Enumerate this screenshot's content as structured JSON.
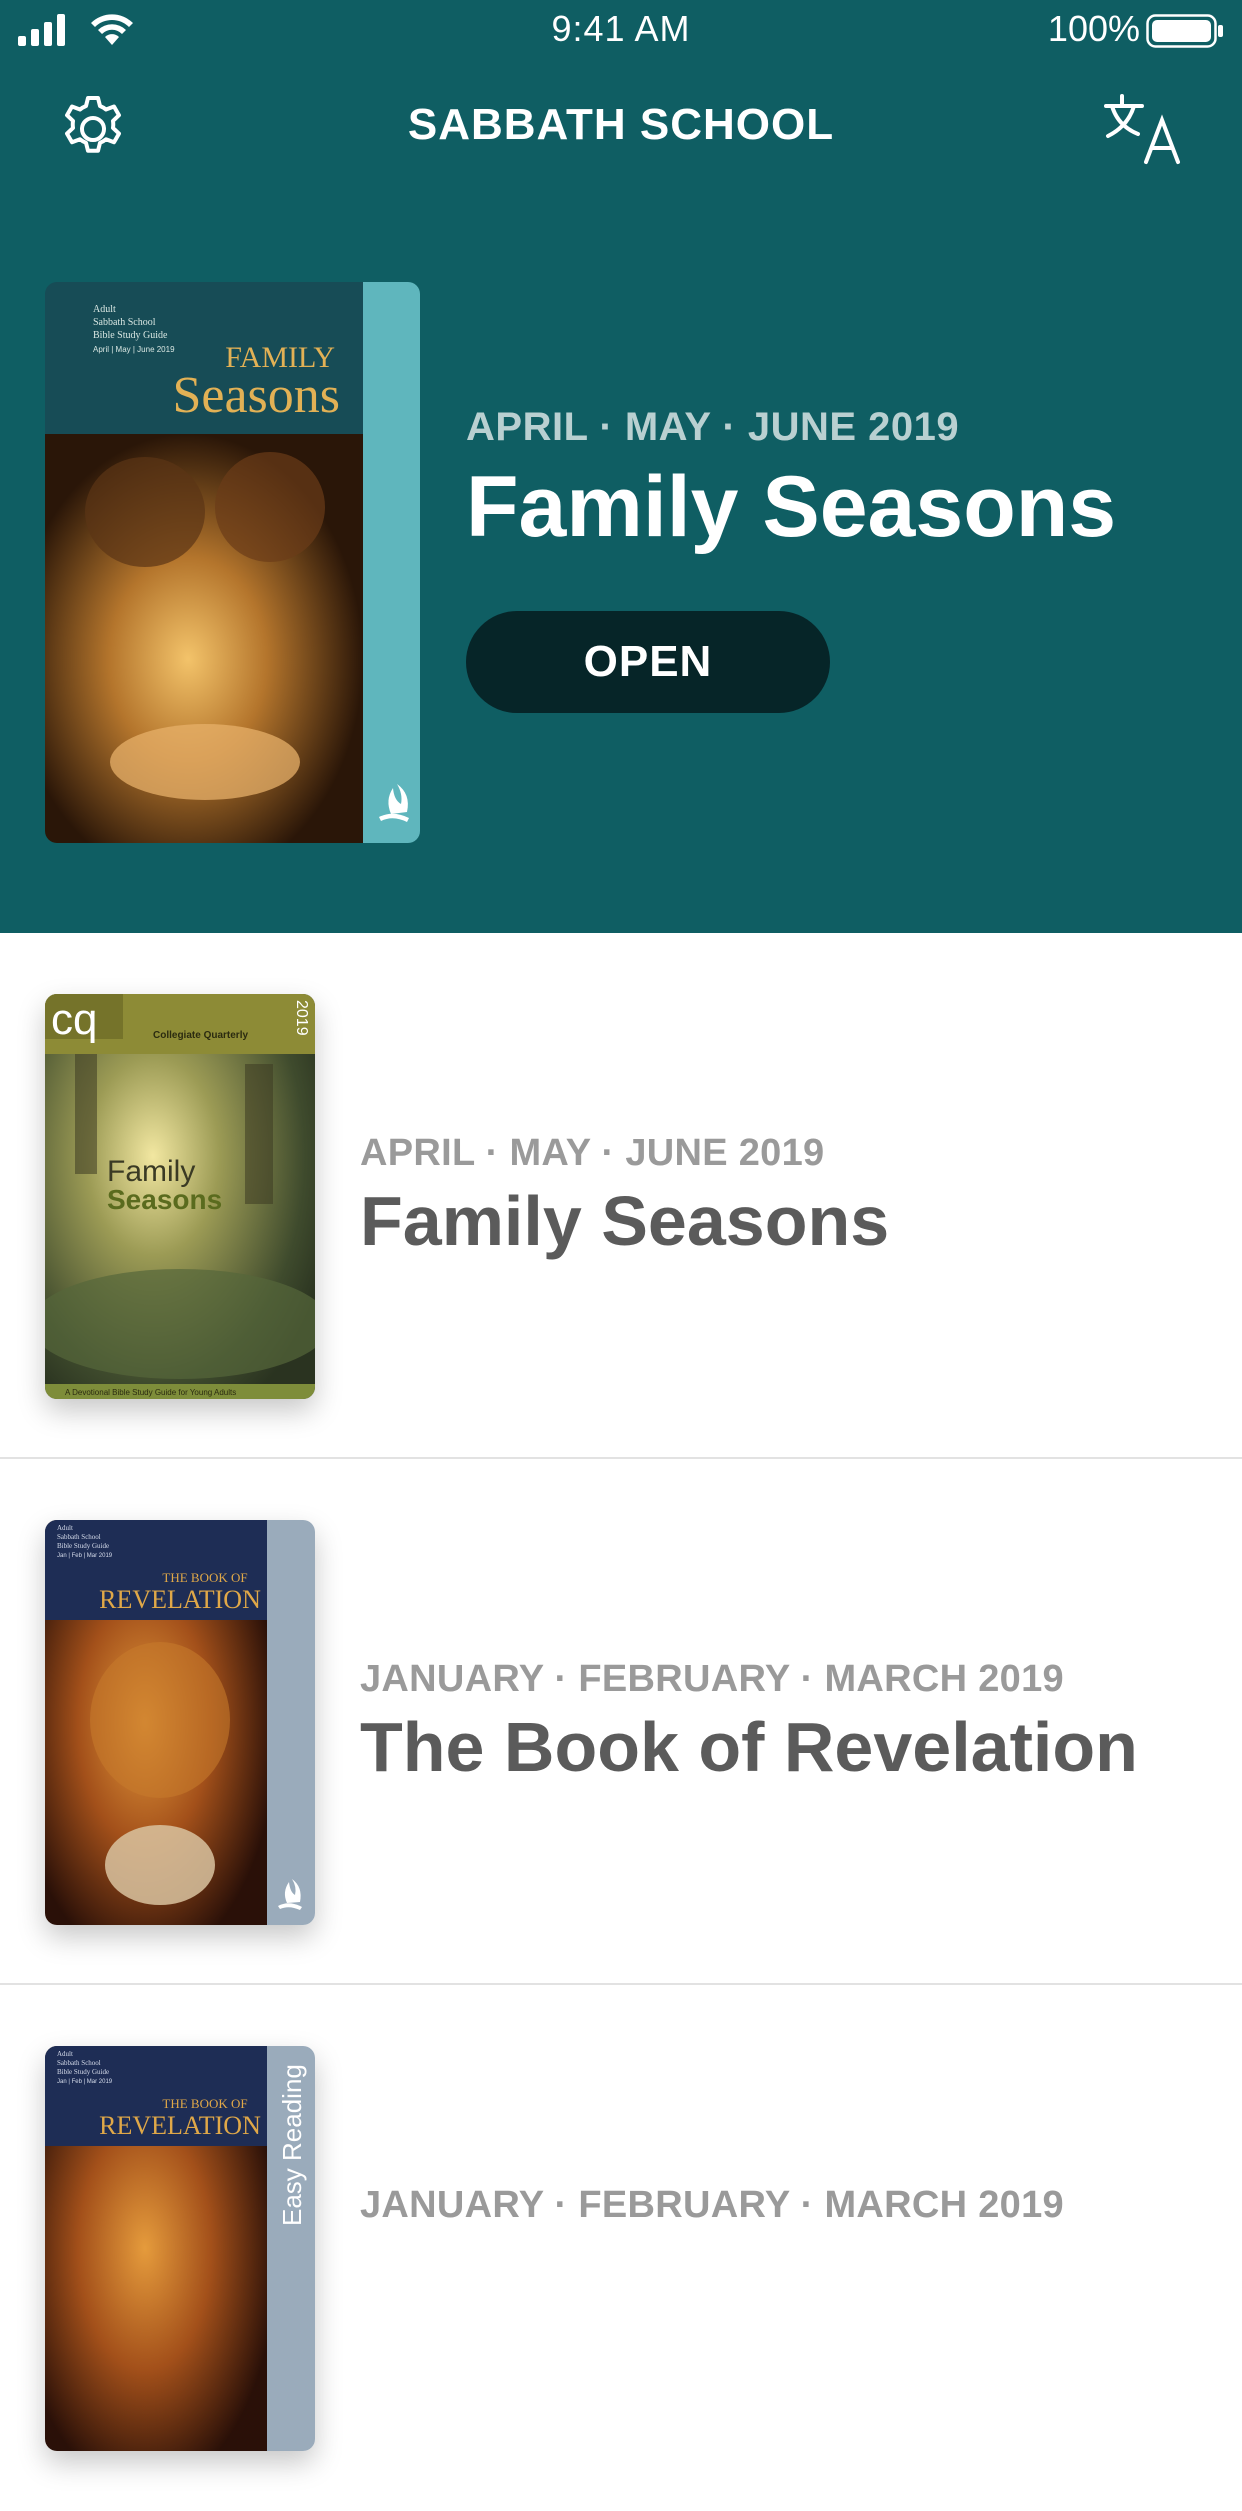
{
  "status": {
    "time": "9:41 AM",
    "battery": "100%"
  },
  "nav": {
    "title": "SABBATH SCHOOL"
  },
  "featured": {
    "date": "APRIL · MAY · JUNE 2019",
    "title": "Family Seasons",
    "open_label": "OPEN",
    "cover": {
      "lines": [
        "Adult",
        "Sabbath School",
        "Bible Study Guide",
        "April | May | June 2019"
      ],
      "title_top": "FAMILY",
      "title_bottom": "Seasons"
    }
  },
  "quarterlies": [
    {
      "date": "APRIL · MAY · JUNE 2019",
      "title": "Family Seasons",
      "cover": {
        "badge": "cq",
        "banner": "Collegiate Quarterly",
        "year": "2019",
        "title_top": "Family",
        "title_bottom": "Seasons",
        "footer": "A Devotional Bible Study Guide for Young Adults"
      }
    },
    {
      "date": "JANUARY · FEBRUARY · MARCH 2019",
      "title": "The Book of Revelation",
      "cover": {
        "lines": [
          "Adult",
          "Sabbath School",
          "Bible Study Guide",
          "Jan | Feb | Mar 2019"
        ],
        "title_top": "THE BOOK OF",
        "title_bottom": "REVELATION"
      }
    },
    {
      "date": "JANUARY · FEBRUARY · MARCH 2019",
      "title": "",
      "cover": {
        "lines": [
          "Adult",
          "Sabbath School",
          "Bible Study Guide",
          "Jan | Feb | Mar 2019"
        ],
        "title_top": "THE BOOK OF",
        "title_bottom": "REVELATION",
        "side_label": "Easy Reading"
      }
    }
  ],
  "colors": {
    "primary": "#0f5e63",
    "button": "#062528",
    "date_gray": "#9a9a9a",
    "title_gray": "#5b5b5b"
  },
  "icons": [
    "signal-icon",
    "wifi-icon",
    "battery-icon",
    "gear-icon",
    "translate-icon",
    "flame-logo-icon"
  ]
}
